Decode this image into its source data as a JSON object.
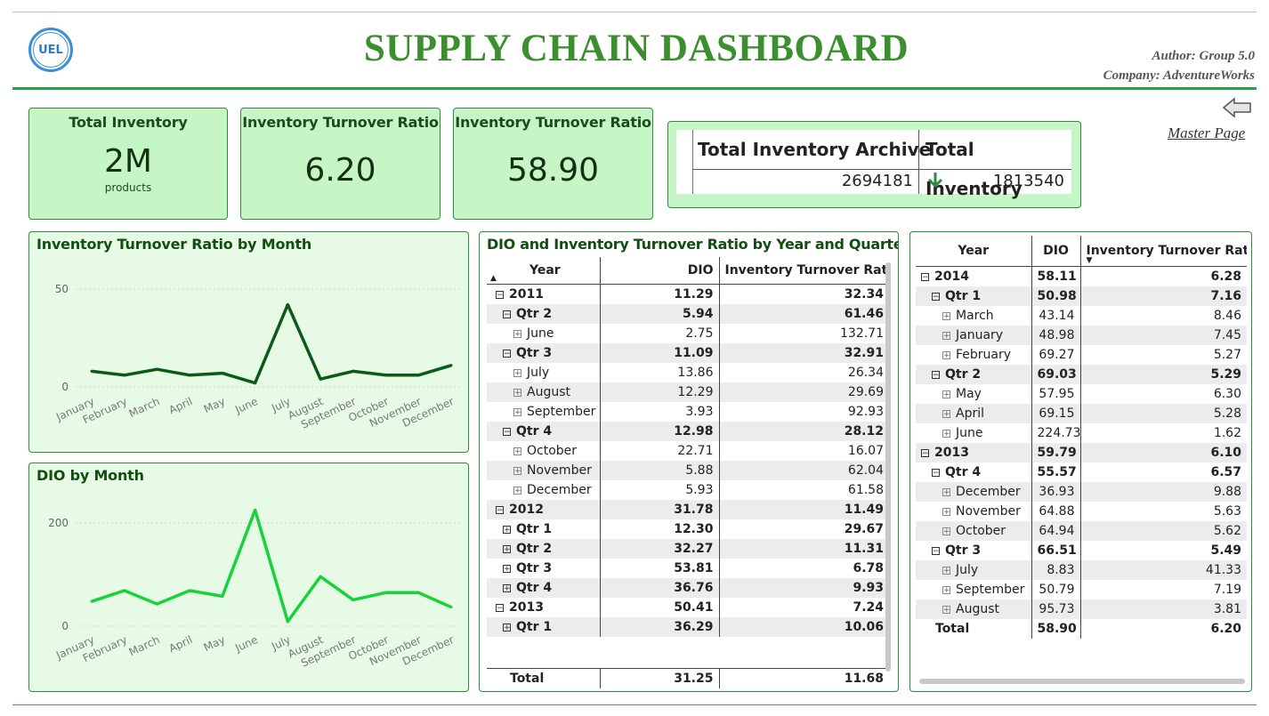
{
  "header": {
    "title": "SUPPLY CHAIN DASHBOARD",
    "logo_text": "UEL",
    "author": "Author: Group 5.0",
    "company": "Company: AdventureWorks"
  },
  "nav": {
    "master_page_label": "Master Page"
  },
  "kpis": [
    {
      "title": "Total Inventory",
      "value": "2M",
      "sub": "products"
    },
    {
      "title": "Inventory Turnover Ratio",
      "value": "6.20"
    },
    {
      "title": "Inventory Turnover Ratio",
      "value": "58.90"
    }
  ],
  "archive": {
    "col1": "Total Inventory Archive",
    "col2": "Total Inventory",
    "val1": "2694181",
    "val2": "1813540",
    "trend": "down",
    "trend_icon": "down-arrow-icon"
  },
  "chart_data": [
    {
      "type": "line",
      "title": "Inventory Turnover Ratio by Month",
      "x": [
        "January",
        "February",
        "March",
        "April",
        "May",
        "June",
        "July",
        "August",
        "September",
        "October",
        "November",
        "December"
      ],
      "series": [
        {
          "values": [
            8,
            6,
            9,
            6,
            7,
            2,
            42,
            4,
            8,
            6,
            6,
            11
          ]
        }
      ],
      "ylim": [
        0,
        50
      ],
      "yticks": [
        "0",
        "50"
      ],
      "color": "#0b5a1a",
      "grid": true
    },
    {
      "type": "line",
      "title": "DIO by Month",
      "x": [
        "January",
        "February",
        "March",
        "April",
        "May",
        "June",
        "July",
        "August",
        "September",
        "October",
        "November",
        "December"
      ],
      "series": [
        {
          "values": [
            48,
            69,
            43,
            69,
            58,
            225,
            9,
            96,
            51,
            65,
            65,
            37
          ]
        }
      ],
      "ylim": [
        0,
        250
      ],
      "yticks": [
        "0",
        "200"
      ],
      "color": "#19d13a",
      "grid": true
    }
  ],
  "matrix1": {
    "title": "DIO and Inventory Turnover Ratio by Year and Quarter",
    "headers": [
      "Year",
      "DIO",
      "Inventory Turnover Ratio"
    ],
    "rows": [
      {
        "indent": 0,
        "icon": "minus",
        "label": "2011",
        "dio": "11.29",
        "itr": "32.34",
        "bold": true
      },
      {
        "indent": 1,
        "icon": "minus",
        "label": "Qtr 2",
        "dio": "5.94",
        "itr": "61.46",
        "bold": true
      },
      {
        "indent": 2,
        "icon": "plus",
        "label": "June",
        "dio": "2.75",
        "itr": "132.71"
      },
      {
        "indent": 1,
        "icon": "minus",
        "label": "Qtr 3",
        "dio": "11.09",
        "itr": "32.91",
        "bold": true
      },
      {
        "indent": 2,
        "icon": "plus",
        "label": "July",
        "dio": "13.86",
        "itr": "26.34"
      },
      {
        "indent": 2,
        "icon": "plus",
        "label": "August",
        "dio": "12.29",
        "itr": "29.69"
      },
      {
        "indent": 2,
        "icon": "plus",
        "label": "September",
        "dio": "3.93",
        "itr": "92.93"
      },
      {
        "indent": 1,
        "icon": "minus",
        "label": "Qtr 4",
        "dio": "12.98",
        "itr": "28.12",
        "bold": true
      },
      {
        "indent": 2,
        "icon": "plus",
        "label": "October",
        "dio": "22.71",
        "itr": "16.07"
      },
      {
        "indent": 2,
        "icon": "plus",
        "label": "November",
        "dio": "5.88",
        "itr": "62.04"
      },
      {
        "indent": 2,
        "icon": "plus",
        "label": "December",
        "dio": "5.93",
        "itr": "61.58"
      },
      {
        "indent": 0,
        "icon": "minus",
        "label": "2012",
        "dio": "31.78",
        "itr": "11.49",
        "bold": true
      },
      {
        "indent": 1,
        "icon": "plus",
        "label": "Qtr 1",
        "dio": "12.30",
        "itr": "29.67",
        "bold": true
      },
      {
        "indent": 1,
        "icon": "plus",
        "label": "Qtr 2",
        "dio": "32.27",
        "itr": "11.31",
        "bold": true
      },
      {
        "indent": 1,
        "icon": "plus",
        "label": "Qtr 3",
        "dio": "53.81",
        "itr": "6.78",
        "bold": true
      },
      {
        "indent": 1,
        "icon": "plus",
        "label": "Qtr 4",
        "dio": "36.76",
        "itr": "9.93",
        "bold": true
      },
      {
        "indent": 0,
        "icon": "minus",
        "label": "2013",
        "dio": "50.41",
        "itr": "7.24",
        "bold": true
      },
      {
        "indent": 1,
        "icon": "plus",
        "label": "Qtr 1",
        "dio": "36.29",
        "itr": "10.06",
        "bold": true
      }
    ],
    "total": {
      "label": "Total",
      "dio": "31.25",
      "itr": "11.68"
    }
  },
  "matrix2": {
    "headers": [
      "Year",
      "DIO",
      "Inventory Turnover Ratio"
    ],
    "rows": [
      {
        "indent": 0,
        "icon": "minus",
        "label": "2014",
        "dio": "58.11",
        "itr": "6.28",
        "bold": true
      },
      {
        "indent": 1,
        "icon": "minus",
        "label": "Qtr 1",
        "dio": "50.98",
        "itr": "7.16",
        "bold": true
      },
      {
        "indent": 2,
        "icon": "plus",
        "label": "March",
        "dio": "43.14",
        "itr": "8.46"
      },
      {
        "indent": 2,
        "icon": "plus",
        "label": "January",
        "dio": "48.98",
        "itr": "7.45"
      },
      {
        "indent": 2,
        "icon": "plus",
        "label": "February",
        "dio": "69.27",
        "itr": "5.27"
      },
      {
        "indent": 1,
        "icon": "minus",
        "label": "Qtr 2",
        "dio": "69.03",
        "itr": "5.29",
        "bold": true
      },
      {
        "indent": 2,
        "icon": "plus",
        "label": "May",
        "dio": "57.95",
        "itr": "6.30"
      },
      {
        "indent": 2,
        "icon": "plus",
        "label": "April",
        "dio": "69.15",
        "itr": "5.28"
      },
      {
        "indent": 2,
        "icon": "plus",
        "label": "June",
        "dio": "224.73",
        "itr": "1.62"
      },
      {
        "indent": 0,
        "icon": "minus",
        "label": "2013",
        "dio": "59.79",
        "itr": "6.10",
        "bold": true
      },
      {
        "indent": 1,
        "icon": "minus",
        "label": "Qtr 4",
        "dio": "55.57",
        "itr": "6.57",
        "bold": true
      },
      {
        "indent": 2,
        "icon": "plus",
        "label": "December",
        "dio": "36.93",
        "itr": "9.88"
      },
      {
        "indent": 2,
        "icon": "plus",
        "label": "November",
        "dio": "64.88",
        "itr": "5.63"
      },
      {
        "indent": 2,
        "icon": "plus",
        "label": "October",
        "dio": "64.94",
        "itr": "5.62"
      },
      {
        "indent": 1,
        "icon": "minus",
        "label": "Qtr 3",
        "dio": "66.51",
        "itr": "5.49",
        "bold": true
      },
      {
        "indent": 2,
        "icon": "plus",
        "label": "July",
        "dio": "8.83",
        "itr": "41.33"
      },
      {
        "indent": 2,
        "icon": "plus",
        "label": "September",
        "dio": "50.79",
        "itr": "7.19"
      },
      {
        "indent": 2,
        "icon": "plus",
        "label": "August",
        "dio": "95.73",
        "itr": "3.81"
      }
    ],
    "total": {
      "label": "Total",
      "dio": "58.90",
      "itr": "6.20"
    }
  }
}
